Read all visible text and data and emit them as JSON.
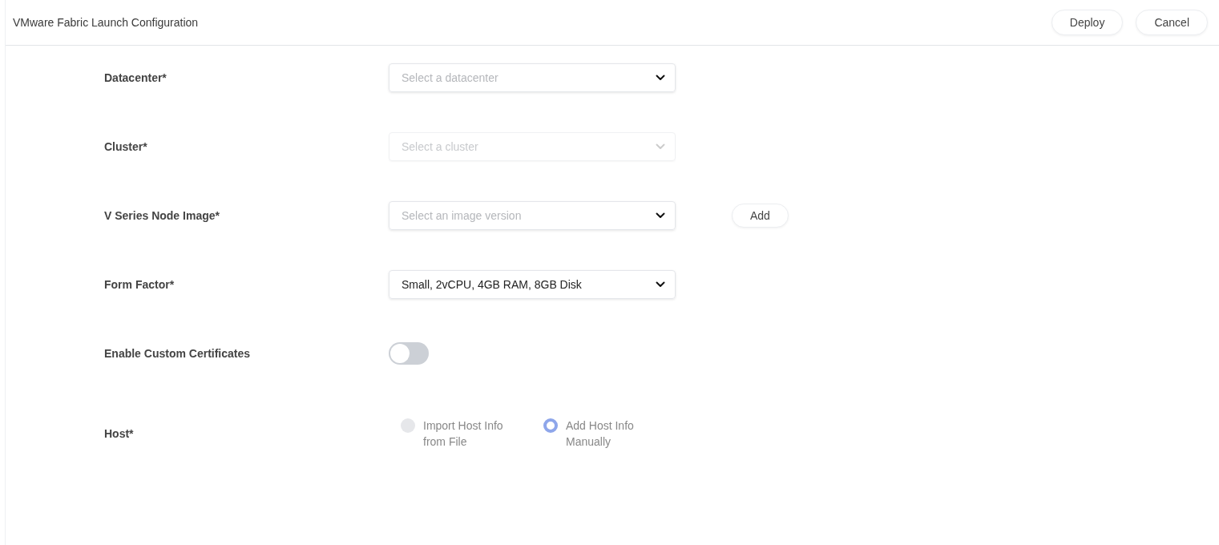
{
  "header": {
    "title": "VMware Fabric Launch Configuration",
    "buttons": [
      "Deploy",
      "Cancel"
    ]
  },
  "fields": [
    {
      "kind": "select",
      "label": "Datacenter*",
      "placeholder": "Select a datacenter",
      "disabled": false
    },
    {
      "kind": "select",
      "label": "Cluster*",
      "placeholder": "Select a cluster",
      "disabled": true
    },
    {
      "kind": "select",
      "label": "V Series Node Image*",
      "placeholder": "Select an image version",
      "disabled": false,
      "action": "Add"
    },
    {
      "kind": "select",
      "label": "Form Factor*",
      "value": "Small, 2vCPU, 4GB RAM, 8GB Disk",
      "disabled": false
    },
    {
      "kind": "toggle",
      "label": "Enable Custom Certificates",
      "on": false
    },
    {
      "kind": "radio",
      "label": "Host*",
      "options": [
        {
          "label": "Import Host Info from File",
          "selected": false
        },
        {
          "label": "Add Host Info Manually",
          "selected": true
        }
      ]
    }
  ]
}
